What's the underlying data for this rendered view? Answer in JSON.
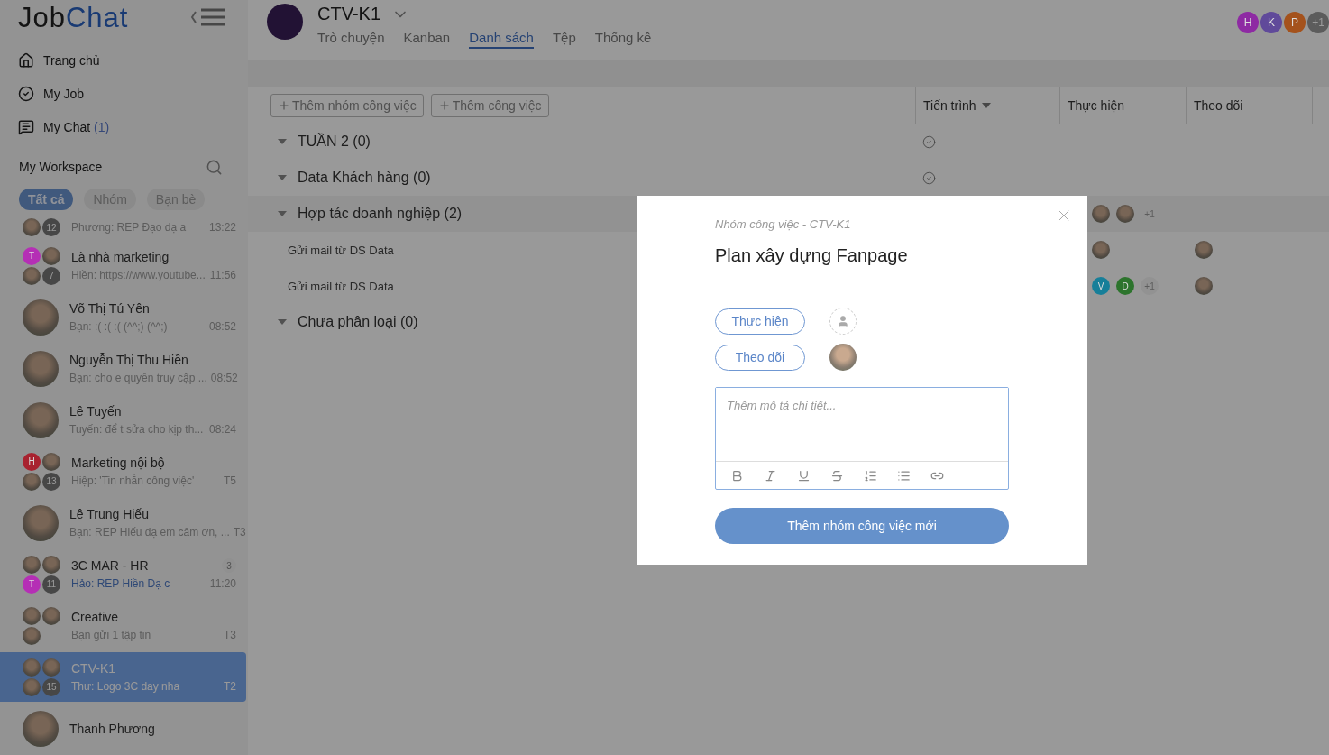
{
  "logo": {
    "parts": [
      "Job",
      "Chat"
    ]
  },
  "nav": [
    {
      "kind": "home",
      "label": "Trang chủ"
    },
    {
      "kind": "job",
      "label": "My Job"
    },
    {
      "kind": "chat",
      "label": "My Chat",
      "count": "(1)"
    }
  ],
  "workspace": {
    "title": "My Workspace",
    "filters": [
      {
        "label": "Tất cả",
        "selected": true
      },
      {
        "label": "Nhóm",
        "selected": false
      },
      {
        "label": "Bạn bè",
        "selected": false
      }
    ]
  },
  "chats": [
    {
      "kind": "group",
      "members": [
        {
          "kind": "photo"
        }
      ],
      "count": "12",
      "preview": "Phương: REP Đạo dạ a",
      "time": "13:22",
      "unread": false,
      "selected": false
    },
    {
      "kind": "group",
      "name": "Là nhà marketing",
      "members": [
        {
          "kind": "letter",
          "letter": "T",
          "color": "#b52fb5"
        },
        {
          "kind": "photo"
        },
        {
          "kind": "photo"
        }
      ],
      "count": "7",
      "preview": "Hiền: https://www.youtube...",
      "time": "11:56",
      "unread": false,
      "selected": false
    },
    {
      "kind": "single",
      "name": "Võ Thị Tú Yên",
      "preview": "Bạn: :( :( :( (^^;) (^^;)",
      "time": "08:52",
      "unread": false,
      "selected": false
    },
    {
      "kind": "single",
      "name": "Nguyễn Thị Thu Hiền",
      "preview": "Bạn: cho e quyền truy cập ...",
      "time": "08:52",
      "unread": false,
      "selected": false
    },
    {
      "kind": "single",
      "name": "Lê Tuyến",
      "preview": "Tuyến: để t sửa cho kịp th...",
      "time": "08:24",
      "unread": false,
      "selected": false
    },
    {
      "kind": "group",
      "name": "Marketing nội bộ",
      "members": [
        {
          "kind": "letter",
          "letter": "H",
          "color": "#a8222f"
        },
        {
          "kind": "photo"
        },
        {
          "kind": "photo"
        }
      ],
      "count": "13",
      "preview": "Hiệp: 'Tin nhắn công việc'",
      "time": "T5",
      "unread": false,
      "selected": false
    },
    {
      "kind": "single",
      "name": "Lê Trung Hiếu",
      "preview": "Bạn: REP Hiếu dạ em cảm ơn, ...",
      "time": "T3",
      "unread": false,
      "selected": false
    },
    {
      "kind": "group",
      "name": "3C MAR - HR",
      "members": [
        {
          "kind": "photo"
        },
        {
          "kind": "photo"
        },
        {
          "kind": "letter",
          "letter": "T",
          "color": "#b52fb5"
        }
      ],
      "count": "11",
      "badge": "3",
      "preview": "Hảo: REP Hiền Dạ c",
      "time": "11:20",
      "unread": true,
      "selected": false
    },
    {
      "kind": "group",
      "name": "Creative",
      "members": [
        {
          "kind": "photo"
        },
        {
          "kind": "photo"
        },
        {
          "kind": "photo"
        }
      ],
      "preview": "Bạn gửi 1 tập tin",
      "time": "T3",
      "unread": false,
      "selected": false
    },
    {
      "kind": "group",
      "name": "CTV-K1",
      "members": [
        {
          "kind": "photo"
        },
        {
          "kind": "photo"
        },
        {
          "kind": "photo"
        }
      ],
      "count": "15",
      "preview": "Thư: Logo 3C day nha",
      "time": "T2",
      "unread": false,
      "selected": true
    },
    {
      "kind": "single",
      "name": "Thanh Phương",
      "selected": false
    }
  ],
  "header": {
    "title": "CTV-K1",
    "tabs": [
      {
        "label": "Trò chuyện",
        "selected": false
      },
      {
        "label": "Kanban",
        "selected": false
      },
      {
        "label": "Danh sách",
        "selected": true
      },
      {
        "label": "Tệp",
        "selected": false
      },
      {
        "label": "Thống kê",
        "selected": false
      }
    ],
    "members": [
      {
        "kind": "letter",
        "letter": "H",
        "color": "#8e2aa3"
      },
      {
        "kind": "letter",
        "letter": "K",
        "color": "#604a9a"
      },
      {
        "kind": "letter",
        "letter": "P",
        "color": "#a4521c"
      },
      {
        "kind": "more",
        "letter": "+1"
      }
    ]
  },
  "toolbar": [
    "Thêm nhóm công việc",
    "Thêm công việc"
  ],
  "columns": [
    {
      "label": "Tiến trình",
      "sortable": true
    },
    {
      "label": "Thực hiện",
      "sortable": false
    },
    {
      "label": "Theo dõi",
      "sortable": false
    }
  ],
  "groups": [
    {
      "title": "TUẦN 2 (0)",
      "expanded": true,
      "done": true
    },
    {
      "title": "Data Khách hàng (0)",
      "expanded": true,
      "done": true
    },
    {
      "title": "Hợp tác doanh nghiệp (2)",
      "expanded": true,
      "done": false,
      "assignees": [
        {
          "kind": "photo"
        },
        {
          "kind": "photo"
        },
        {
          "kind": "more",
          "letter": "+1"
        }
      ],
      "tasks": [
        {
          "title": "Gửi mail từ DS Data",
          "assignees": [
            {
              "kind": "photo"
            }
          ],
          "followers": [
            {
              "kind": "photo"
            }
          ]
        },
        {
          "title": "Gửi mail từ DS Data",
          "assignees": [
            {
              "kind": "letter",
              "letter": "V",
              "color": "#177f99"
            },
            {
              "kind": "letter",
              "letter": "D",
              "color": "#2d742d"
            },
            {
              "kind": "more",
              "letter": "+1"
            }
          ],
          "followers": [
            {
              "kind": "photo"
            }
          ]
        }
      ]
    },
    {
      "title": "Chưa phân loại (0)",
      "expanded": true,
      "done": false
    }
  ],
  "modal": {
    "subtitle": "Nhóm công việc - CTV-K1",
    "title": "Plan xây dựng Fanpage",
    "roles": [
      {
        "label": "Thực hiện",
        "assigned": false
      },
      {
        "label": "Theo dõi",
        "assigned": true
      }
    ],
    "description": {
      "placeholder": "Thêm mô tả chi tiết..."
    },
    "submit": "Thêm nhóm công việc mới"
  }
}
